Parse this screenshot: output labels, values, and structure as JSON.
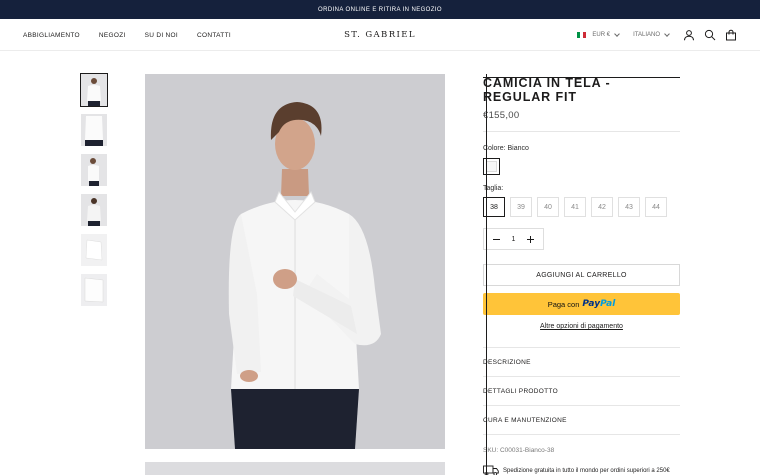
{
  "announcement": "ORDINA ONLINE E RITIRA IN NEGOZIO",
  "nav": {
    "items": [
      "ABBIGLIAMENTO",
      "NEGOZI",
      "SU DI NOI",
      "CONTATTI"
    ],
    "logo": "ST. GABRIEL",
    "currency": "EUR €",
    "language": "ITALIANO"
  },
  "product": {
    "title": "CAMICIA IN TELA - REGULAR FIT",
    "price": "€155,00",
    "color_label": "Colore: Bianco",
    "size_label": "Taglia:",
    "sizes": [
      "38",
      "39",
      "40",
      "41",
      "42",
      "43",
      "44"
    ],
    "selected_size": "38",
    "quantity": "1",
    "add_to_cart": "AGGIUNGI AL CARRELLO",
    "paypal_prefix": "Paga con",
    "paypal_logo_a": "Pay",
    "paypal_logo_b": "Pal",
    "alt_payment": "Altre opzioni di pagamento",
    "accordions": [
      "DESCRIZIONE",
      "DETTAGLI PRODOTTO",
      "CURA E MANUTENZIONE"
    ],
    "sku": "SKU: C00031-Bianco-38",
    "shipping": "Spedizione gratuita in tutto il mondo per ordini superiori a 250€"
  },
  "colors": {
    "announcement_bg": "#15213c",
    "paypal_bg": "#ffc439"
  }
}
